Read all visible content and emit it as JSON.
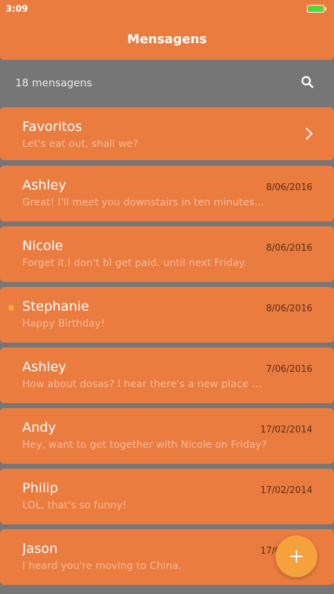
{
  "status_bar": {
    "time": "3:09",
    "battery_level": 1.0
  },
  "header": {
    "title": "Mensagens"
  },
  "toolbar": {
    "count_label": "18 mensagens",
    "search_icon": "search-icon"
  },
  "favorites": {
    "title": "Favoritos",
    "preview": "Let's eat out, shall we?",
    "icon": "chevron-right-icon"
  },
  "messages": [
    {
      "name": "Ashley",
      "date": "8/06/2016",
      "preview": "Great! I'll meet you downstairs in ten minutes. D…",
      "unread": false
    },
    {
      "name": "Nicole",
      "date": "8/06/2016",
      "preview": "Forget it.I don't bl get paid. until next Friday.",
      "unread": false
    },
    {
      "name": "Stephanie",
      "date": "8/06/2016",
      "preview": "Happy Birthday!",
      "unread": true
    },
    {
      "name": "Ashley",
      "date": "7/06/2016",
      "preview": "How about dosas? I hear there's a new place do…",
      "unread": false
    },
    {
      "name": "Andy",
      "date": "17/02/2014",
      "preview": "Hey, want to get together with Nicole on Friday?",
      "unread": false
    },
    {
      "name": "Philip",
      "date": "17/02/2014",
      "preview": "LOL, that's so funny!",
      "unread": false
    },
    {
      "name": "Jason",
      "date": "17/02/2014",
      "preview": "I heard you're moving to China.",
      "unread": false
    }
  ],
  "fab": {
    "icon": "plus-icon"
  },
  "colors": {
    "accent": "#EA7C40",
    "background": "#767676",
    "fab": "#F5A13C",
    "unread_dot": "#F5B52A",
    "battery": "#3EE23E"
  }
}
